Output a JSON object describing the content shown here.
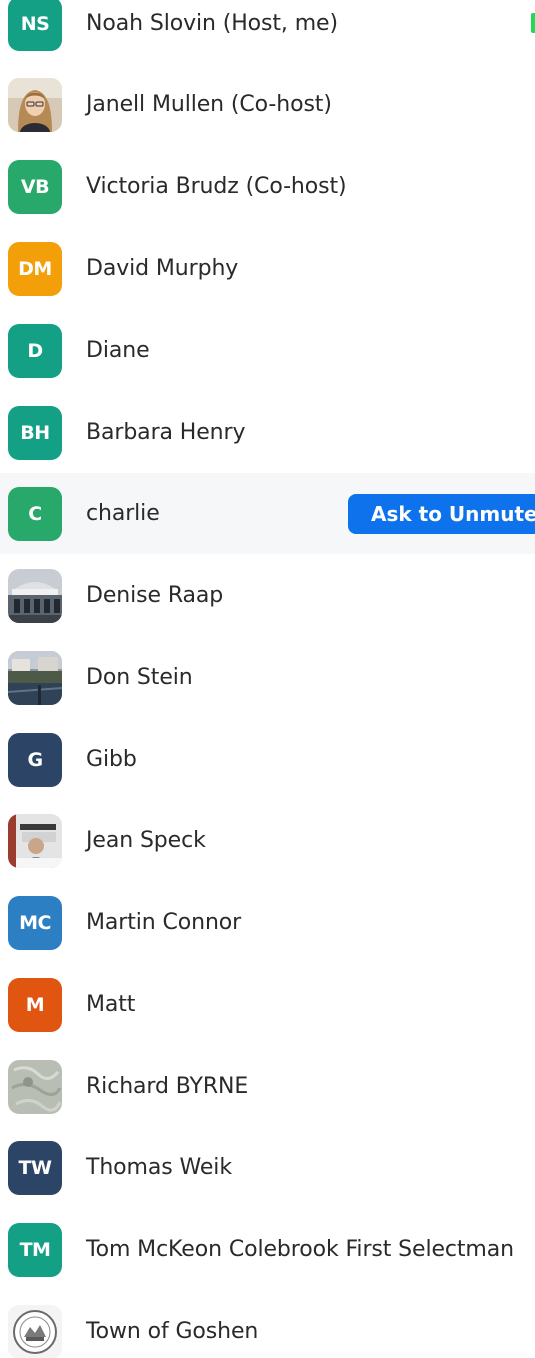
{
  "participants": [
    {
      "name": "Noah Slovin (Host, me)",
      "initials": "NS",
      "color": "#14a085",
      "avatar": "initials"
    },
    {
      "name": "Janell Mullen (Co-host)",
      "initials": "",
      "color": "#c9a98a",
      "avatar": "photo-person-icon"
    },
    {
      "name": "Victoria Brudz (Co-host)",
      "initials": "VB",
      "color": "#28a86a",
      "avatar": "initials"
    },
    {
      "name": "David Murphy",
      "initials": "DM",
      "color": "#f29f0a",
      "avatar": "initials"
    },
    {
      "name": "Diane",
      "initials": "D",
      "color": "#14a085",
      "avatar": "initials"
    },
    {
      "name": "Barbara Henry",
      "initials": "BH",
      "color": "#14a085",
      "avatar": "initials"
    },
    {
      "name": "charlie",
      "initials": "C",
      "color": "#28a86a",
      "avatar": "initials"
    },
    {
      "name": "Denise Raap",
      "initials": "",
      "color": "#7d8a96",
      "avatar": "photo-building-icon"
    },
    {
      "name": "Don Stein",
      "initials": "",
      "color": "#4b5a6a",
      "avatar": "photo-waterfront-icon"
    },
    {
      "name": "Gibb",
      "initials": "G",
      "color": "#2c4566",
      "avatar": "initials"
    },
    {
      "name": "Jean Speck",
      "initials": "",
      "color": "#6b6b6b",
      "avatar": "photo-room-icon"
    },
    {
      "name": "Martin Connor",
      "initials": "MC",
      "color": "#2d7fc4",
      "avatar": "initials"
    },
    {
      "name": "Matt",
      "initials": "M",
      "color": "#e0550f",
      "avatar": "initials"
    },
    {
      "name": "Richard BYRNE",
      "initials": "",
      "color": "#b8bcb2",
      "avatar": "photo-texture-icon"
    },
    {
      "name": "Thomas Weik",
      "initials": "TW",
      "color": "#2c4566",
      "avatar": "initials"
    },
    {
      "name": "Tom McKeon Colebrook First Selectman",
      "initials": "TM",
      "color": "#14a085",
      "avatar": "initials"
    },
    {
      "name": "Town of Goshen",
      "initials": "",
      "color": "#e8e8e8",
      "avatar": "photo-seal-icon"
    }
  ],
  "ask_to_unmute": {
    "label": "Ask to Unmute",
    "row": 6
  },
  "accent_colors": {
    "button": "#0e72ed",
    "status": "#23d959"
  }
}
